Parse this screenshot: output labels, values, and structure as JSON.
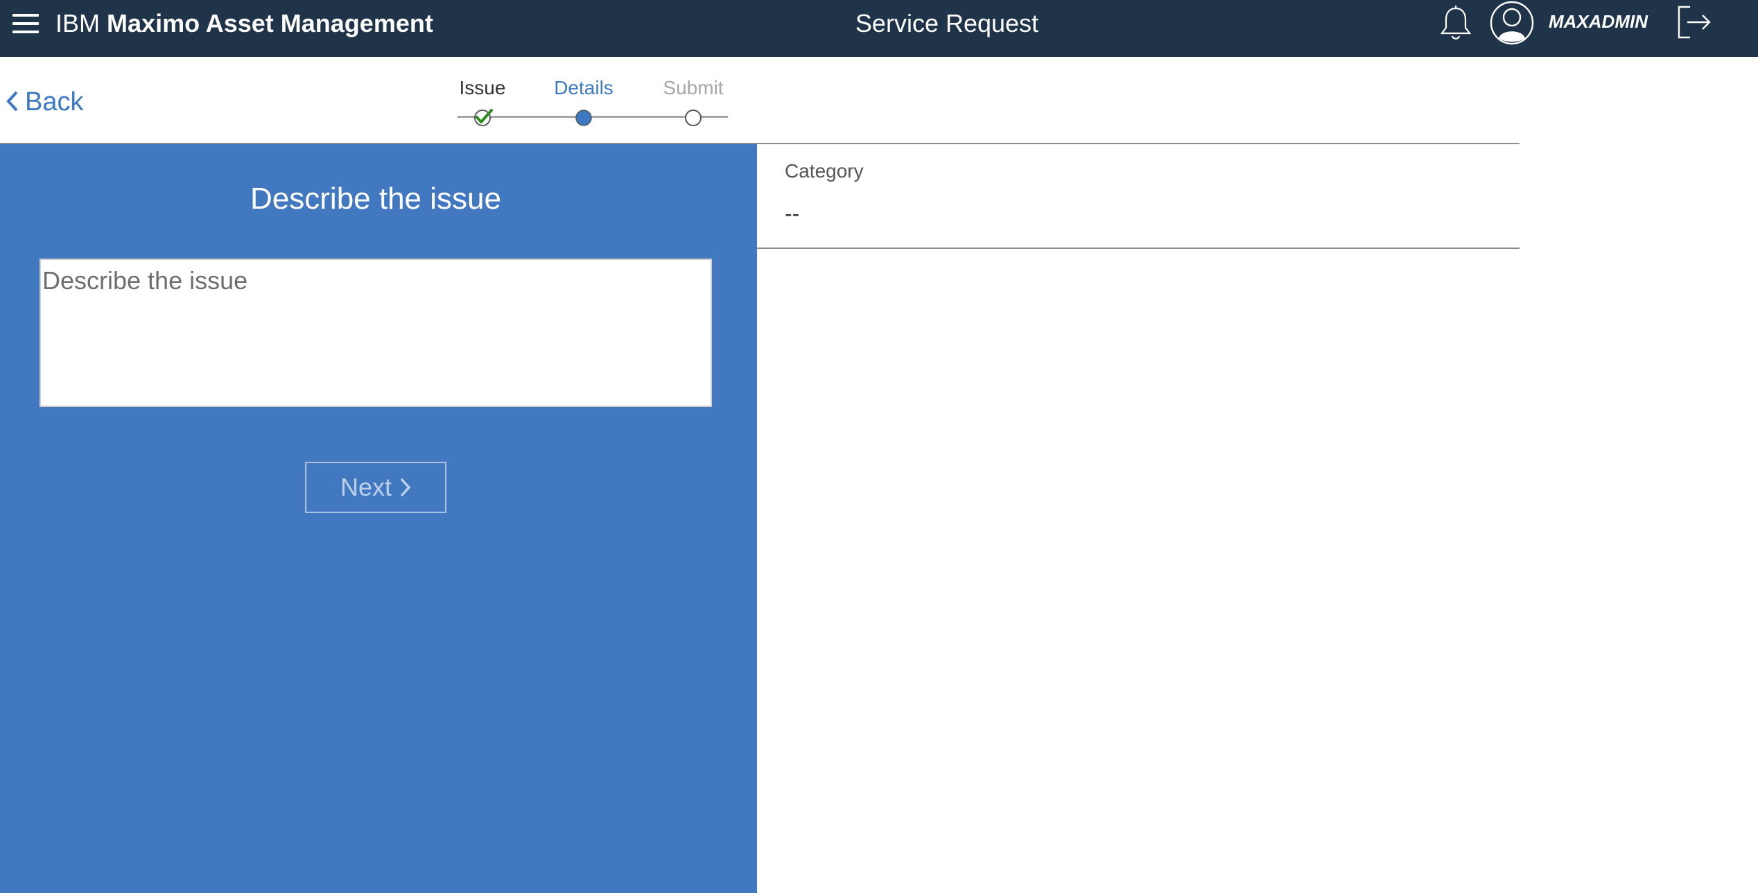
{
  "header": {
    "brand_prefix": "IBM",
    "brand_name": "Maximo Asset Management",
    "title": "Service Request",
    "username": "MAXADMIN",
    "icons": [
      "menu-icon",
      "bell-icon",
      "user-avatar-icon",
      "logout-icon"
    ],
    "background_color": "#1f3349"
  },
  "nav": {
    "back_label": "Back"
  },
  "stepper": {
    "steps": [
      {
        "label": "Issue",
        "state": "complete"
      },
      {
        "label": "Details",
        "state": "current"
      },
      {
        "label": "Submit",
        "state": "pending"
      }
    ],
    "complete_color": "#2e8b1e",
    "current_color": "#3d79c2"
  },
  "left_panel": {
    "title": "Describe the issue",
    "input_placeholder": "Describe the issue",
    "input_value": "",
    "next_label": "Next",
    "background_color": "#4178c0"
  },
  "details": {
    "category_label": "Category",
    "category_value": "--"
  }
}
